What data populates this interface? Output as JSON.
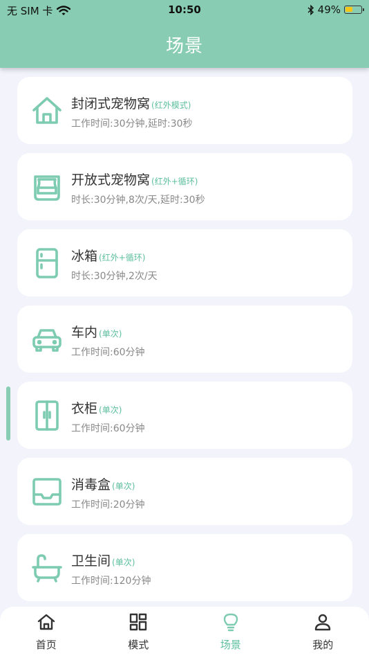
{
  "status_bar": {
    "carrier": "无 SIM 卡",
    "time": "10:50",
    "battery": "49%",
    "battery_level": 0.49
  },
  "header": {
    "title": "场景"
  },
  "scenes": [
    {
      "title": "封闭式宠物窝",
      "tag": "(红外模式)",
      "detail": "工作时间:30分钟,延时:30秒",
      "icon": "house-icon"
    },
    {
      "title": "开放式宠物窝",
      "tag": "(红外+循环)",
      "detail": "时长:30分钟,8次/天,延时:30秒",
      "icon": "pet-bed-icon"
    },
    {
      "title": "冰箱",
      "tag": "(红外+循环)",
      "detail": "时长:30分钟,2次/天",
      "icon": "fridge-icon"
    },
    {
      "title": "车内",
      "tag": "(单次)",
      "detail": "工作时间:60分钟",
      "icon": "car-icon"
    },
    {
      "title": "衣柜",
      "tag": "(单次)",
      "detail": "工作时间:60分钟",
      "icon": "wardrobe-icon"
    },
    {
      "title": "消毒盒",
      "tag": "(单次)",
      "detail": "工作时间:20分钟",
      "icon": "tray-icon"
    },
    {
      "title": "卫生间",
      "tag": "(单次)",
      "detail": "工作时间:120分钟",
      "icon": "bathtub-icon"
    }
  ],
  "tabbar": {
    "items": [
      {
        "label": "首页",
        "icon": "home-icon"
      },
      {
        "label": "模式",
        "icon": "grid-icon"
      },
      {
        "label": "场景",
        "icon": "bulb-icon",
        "active": true
      },
      {
        "label": "我的",
        "icon": "user-icon"
      }
    ]
  },
  "colors": {
    "accent": "#88cdb3",
    "icon": "#7dcbb0",
    "tag": "#5cbf9d",
    "background": "#f2f3fb"
  }
}
